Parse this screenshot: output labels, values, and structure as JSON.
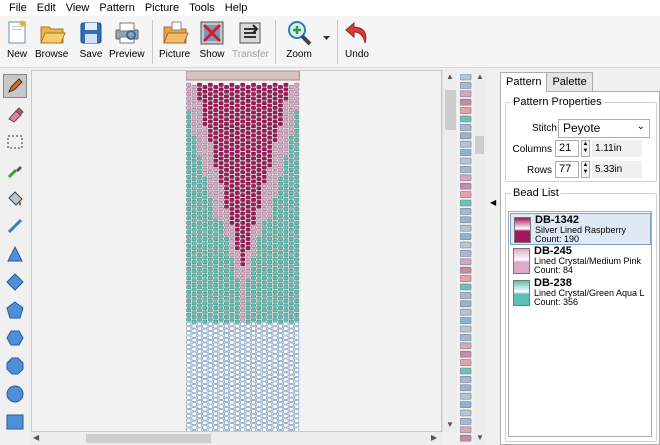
{
  "menu": [
    "File",
    "Edit",
    "View",
    "Pattern",
    "Picture",
    "Tools",
    "Help"
  ],
  "toolbar": {
    "new": "New",
    "browse": "Browse",
    "save": "Save",
    "preview": "Preview",
    "picture": "Picture",
    "show": "Show",
    "transfer": "Transfer",
    "zoom": "Zoom",
    "undo": "Undo"
  },
  "tabs": {
    "pattern": "Pattern",
    "palette": "Palette"
  },
  "properties": {
    "legend": "Pattern Properties",
    "stitch_label": "Stitch",
    "stitch_value": "Peyote",
    "columns_label": "Columns",
    "columns_value": "21",
    "columns_size": "1.11in",
    "rows_label": "Rows",
    "rows_value": "77",
    "rows_size": "5.33in"
  },
  "bead_list": {
    "legend": "Bead List",
    "items": [
      {
        "code": "DB-1342",
        "name": "Silver Lined Raspberry",
        "count": "Count: 190",
        "color": "#a5165a"
      },
      {
        "code": "DB-245",
        "name": "Lined Crystal/Medium Pink",
        "count": "Count: 84",
        "color": "#dca9c8"
      },
      {
        "code": "DB-238",
        "name": "Lined Crystal/Green Aqua L",
        "count": "Count: 356",
        "color": "#5cc0b4"
      }
    ]
  },
  "colors": {
    "raspberry": "#a5165a",
    "pink": "#dca9c8",
    "aqua": "#5cc0b4",
    "blank": "#ffffff",
    "bead_outline": "#6a8fb8"
  }
}
